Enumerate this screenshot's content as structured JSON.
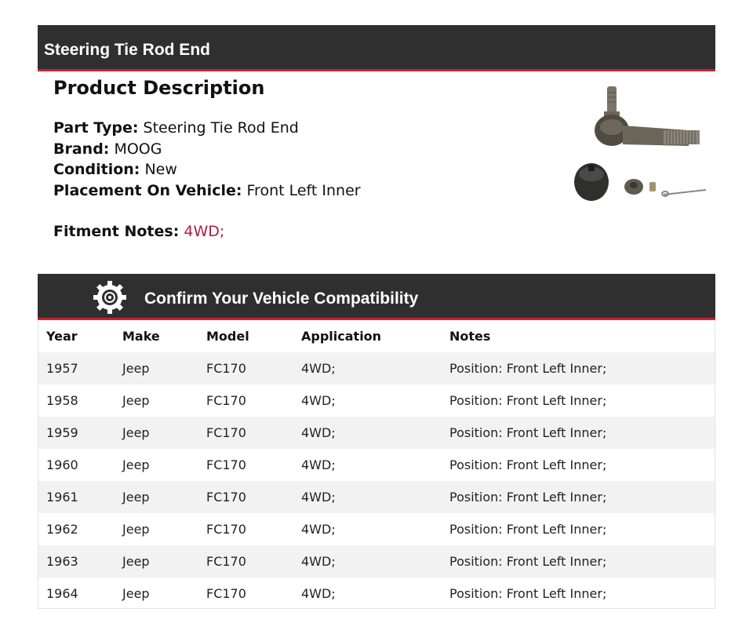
{
  "header": {
    "title": "Steering Tie Rod End"
  },
  "description": {
    "heading": "Product Description",
    "specs": [
      {
        "label": "Part Type:",
        "value": "Steering Tie Rod End"
      },
      {
        "label": "Brand:",
        "value": "MOOG"
      },
      {
        "label": "Condition:",
        "value": "New"
      },
      {
        "label": "Placement On Vehicle:",
        "value": "Front Left Inner"
      }
    ],
    "fitment_label": "Fitment Notes:",
    "fitment_value": "4WD;",
    "fitment_color": "#b11c44"
  },
  "image": {
    "icon": "tie-rod-end-product-image"
  },
  "compat": {
    "title": "Confirm Your Vehicle Compatibility",
    "icon": "gear-icon",
    "columns": [
      "Year",
      "Make",
      "Model",
      "Application",
      "Notes"
    ],
    "rows": [
      [
        "1957",
        "Jeep",
        "FC170",
        "4WD;",
        "Position: Front Left Inner;"
      ],
      [
        "1958",
        "Jeep",
        "FC170",
        "4WD;",
        "Position: Front Left Inner;"
      ],
      [
        "1959",
        "Jeep",
        "FC170",
        "4WD;",
        "Position: Front Left Inner;"
      ],
      [
        "1960",
        "Jeep",
        "FC170",
        "4WD;",
        "Position: Front Left Inner;"
      ],
      [
        "1961",
        "Jeep",
        "FC170",
        "4WD;",
        "Position: Front Left Inner;"
      ],
      [
        "1962",
        "Jeep",
        "FC170",
        "4WD;",
        "Position: Front Left Inner;"
      ],
      [
        "1963",
        "Jeep",
        "FC170",
        "4WD;",
        "Position: Front Left Inner;"
      ],
      [
        "1964",
        "Jeep",
        "FC170",
        "4WD;",
        "Position: Front Left Inner;"
      ]
    ]
  },
  "colors": {
    "header_bg": "#2f2f2f",
    "accent": "#d0202a",
    "row_alt": "#f2f2f2"
  }
}
